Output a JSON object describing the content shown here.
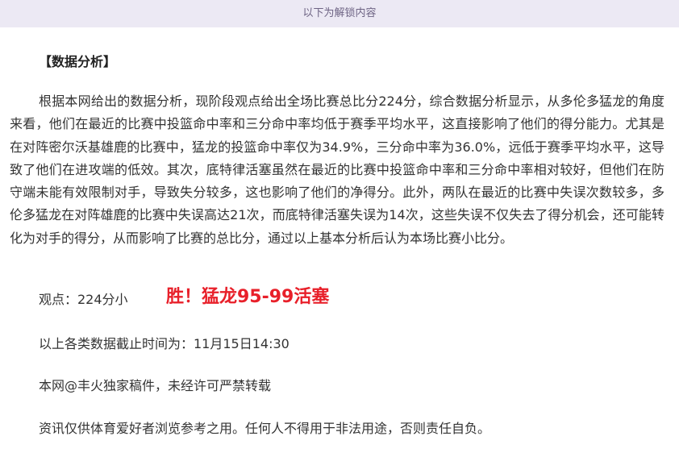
{
  "unlock_banner": {
    "text": "以下为解锁内容"
  },
  "article": {
    "section_title": "【数据分析】",
    "body": "根据本网给出的数据分析，现阶段观点给出全场比赛总比分224分，综合数据分析显示，从多伦多猛龙的角度来看，他们在最近的比赛中投篮命中率和三分命中率均低于赛季平均水平，这直接影响了他们的得分能力。尤其是在对阵密尔沃基雄鹿的比赛中，猛龙的投篮命中率仅为34.9%，三分命中率为36.0%，远低于赛季平均水平，这导致了他们在进攻端的低效。其次，底特律活塞虽然在最近的比赛中投篮命中率和三分命中率相对较好，但他们在防守端未能有效限制对手，导致失分较多，这也影响了他们的净得分。此外，两队在最近的比赛中失误次数较多，多伦多猛龙在对阵雄鹿的比赛中失误高达21次，而底特律活塞失误为14次，这些失误不仅失去了得分机会，还可能转化为对手的得分，从而影响了比赛的总比分，通过以上基本分析后认为本场比赛小比分。",
    "opinion_label": "观点：224分小",
    "opinion_result": "胜！猛龙95-99活塞",
    "data_cutoff": "以上各类数据截止时间为：11月15日14:30",
    "copyright": "本网@丰火独家稿件，未经许可严禁转载",
    "disclaimer": "资讯仅供体育爱好者浏览参考之用。任何人不得用于非法用途，否则责任自负。"
  },
  "colors": {
    "banner_bg": "#ece9f4",
    "banner_text": "#6e6484",
    "result_red": "#e8202a"
  }
}
